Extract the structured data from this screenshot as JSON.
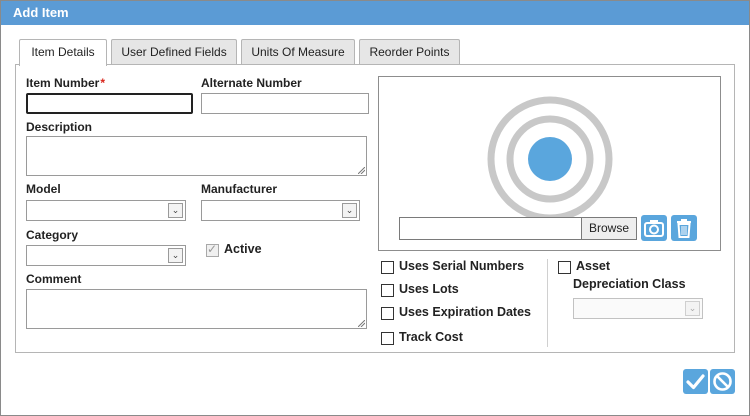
{
  "window": {
    "title": "Add Item"
  },
  "tabs": [
    {
      "label": "Item Details"
    },
    {
      "label": "User Defined Fields"
    },
    {
      "label": "Units Of Measure"
    },
    {
      "label": "Reorder Points"
    }
  ],
  "form": {
    "item_number": {
      "label": "Item Number",
      "required_mark": "*",
      "value": ""
    },
    "alternate_number": {
      "label": "Alternate Number",
      "value": ""
    },
    "description": {
      "label": "Description",
      "value": ""
    },
    "model": {
      "label": "Model",
      "value": ""
    },
    "manufacturer": {
      "label": "Manufacturer",
      "value": ""
    },
    "category": {
      "label": "Category",
      "value": ""
    },
    "active": {
      "label": "Active",
      "checked": true,
      "disabled": true
    },
    "comment": {
      "label": "Comment",
      "value": ""
    }
  },
  "image_area": {
    "browse_label": "Browse",
    "camera_icon": "camera-icon",
    "trash_icon": "trash-icon",
    "placeholder_icon": "target-placeholder-icon",
    "accent_color": "#5aa6dd"
  },
  "options": {
    "uses_serial_numbers": {
      "label": "Uses Serial Numbers",
      "checked": false
    },
    "uses_lots": {
      "label": "Uses Lots",
      "checked": false
    },
    "uses_expiration_dates": {
      "label": "Uses Expiration Dates",
      "checked": false
    },
    "track_cost": {
      "label": "Track Cost",
      "checked": false
    }
  },
  "asset": {
    "label": "Asset",
    "checked": false,
    "depreciation_class": {
      "label": "Depreciation Class",
      "value": "",
      "disabled": true
    }
  },
  "footer": {
    "ok_icon": "checkmark-icon",
    "cancel_icon": "cancel-icon"
  },
  "colors": {
    "titlebar": "#5b9bd5",
    "button": "#5aa6dd",
    "required": "#d9261c"
  }
}
